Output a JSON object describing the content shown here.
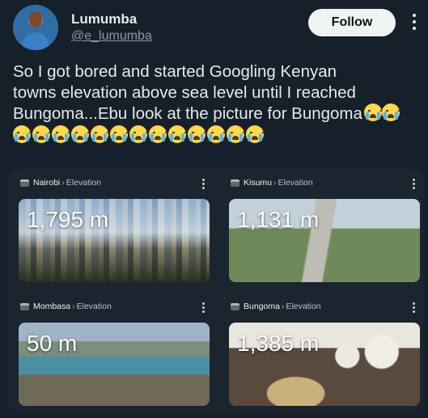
{
  "author": {
    "name": "Lumumba",
    "handle": "@e_lumumba"
  },
  "follow_label": "Follow",
  "tweet": {
    "text_line1": "So I got bored and started Googling Kenyan",
    "text_line2": "towns elevation above sea level until I reached",
    "text_line3": "Bungoma...Ebu look at the picture for Bungoma",
    "inline_emoji_count": 2,
    "row_emoji_count": 13,
    "emoji_name": "loudly-crying-face"
  },
  "cards": [
    {
      "city": "Nairobi",
      "sep": "›",
      "metric": "Elevation",
      "value": "1,795 m"
    },
    {
      "city": "Kisumu",
      "sep": "›",
      "metric": "Elevation",
      "value": "1,131 m"
    },
    {
      "city": "Mombasa",
      "sep": "›",
      "metric": "Elevation",
      "value": "50 m"
    },
    {
      "city": "Bungoma",
      "sep": "›",
      "metric": "Elevation",
      "value": "1,385 m"
    }
  ],
  "colors": {
    "background": "#15202b",
    "text": "#e7e9ea",
    "muted": "#8b98a5",
    "follow_bg": "#eff3f4"
  }
}
